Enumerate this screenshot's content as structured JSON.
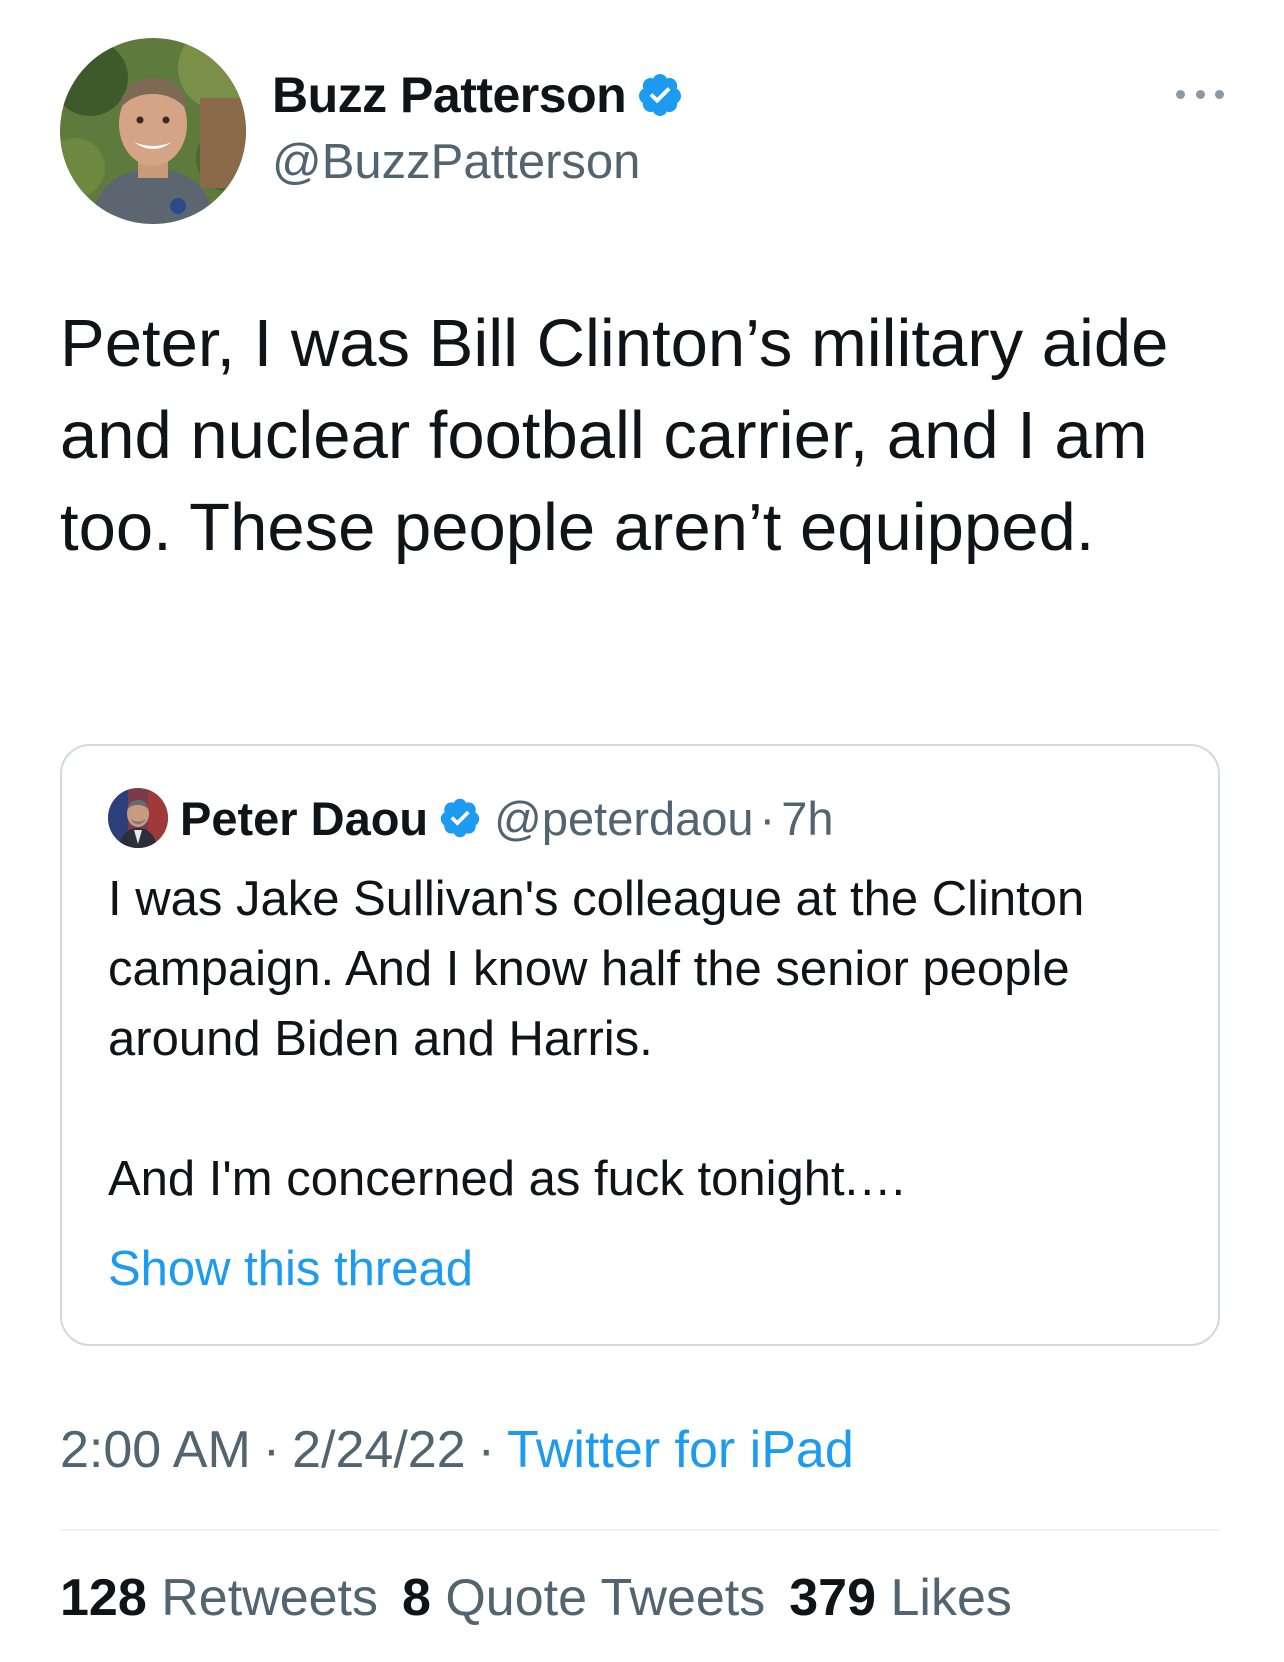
{
  "tweet": {
    "author": {
      "display_name": "Buzz Patterson",
      "handle": "@BuzzPatterson",
      "verified": true
    },
    "text": "Peter, I was Bill Clinton’s military aide and nuclear football carrier, and I am too. These people aren’t equipped.",
    "timestamp": "2:00 AM",
    "date": "2/24/22",
    "source": "Twitter for iPad",
    "stats": {
      "retweets_count": "128",
      "retweets_label": "Retweets",
      "quotes_count": "8",
      "quotes_label": "Quote Tweets",
      "likes_count": "379",
      "likes_label": "Likes"
    }
  },
  "quoted_tweet": {
    "display_name": "Peter Daou",
    "handle": "@peterdaou",
    "separator": "·",
    "time": "7h",
    "verified": true,
    "paragraph1": "I was Jake Sullivan's colleague at the Clinton campaign. And I know half the senior people around Biden and Harris.",
    "paragraph2": "And I'm concerned as fuck tonight.…",
    "show_thread": "Show this thread"
  },
  "meta_separator": "·",
  "icons": {
    "verified": "verified-badge-icon",
    "more": "more-options-icon"
  },
  "colors": {
    "accent": "#1d9bf0",
    "text": "#0f1419",
    "secondary": "#536471",
    "border": "#cfd9de"
  }
}
